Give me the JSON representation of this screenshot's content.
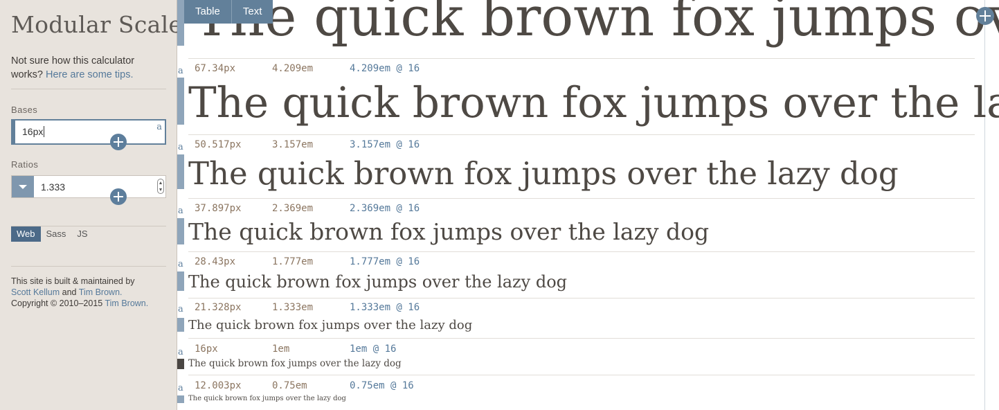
{
  "sidebar": {
    "title": "Modular Scale",
    "intro_text": "Not sure how this calculator works?",
    "intro_link": "Here are some tips.",
    "bases_label": "Bases",
    "base_value": "16px",
    "ratios_label": "Ratios",
    "ratio_value": "1.333",
    "corner_mark": "a",
    "tabs": [
      "Web",
      "Sass",
      "JS"
    ],
    "active_tab": "Web",
    "footer_line1": "This site is built & maintained by",
    "author1": "Scott Kellum",
    "and_text": "and",
    "author2": "Tim Brown.",
    "copyright": "Copyright © 2010–2015",
    "copyright_author": "Tim Brown."
  },
  "main": {
    "tabs": [
      "Table",
      "Text"
    ],
    "sample_text": "The quick brown fox jumps over the lazy dog",
    "rows": [
      {
        "a": "a",
        "px": "67.34px",
        "em": "4.209em",
        "em16": "4.209em @ 16"
      },
      {
        "a": "a",
        "px": "50.517px",
        "em": "3.157em",
        "em16": "3.157em @ 16"
      },
      {
        "a": "a",
        "px": "37.897px",
        "em": "2.369em",
        "em16": "2.369em @ 16"
      },
      {
        "a": "a",
        "px": "28.43px",
        "em": "1.777em",
        "em16": "1.777em @ 16"
      },
      {
        "a": "a",
        "px": "21.328px",
        "em": "1.333em",
        "em16": "1.333em @ 16"
      },
      {
        "a": "a",
        "px": "16px",
        "em": "1em",
        "em16": "1em @ 16"
      },
      {
        "a": "a",
        "px": "12.003px",
        "em": "0.75em",
        "em16": "0.75em @ 16"
      }
    ]
  }
}
